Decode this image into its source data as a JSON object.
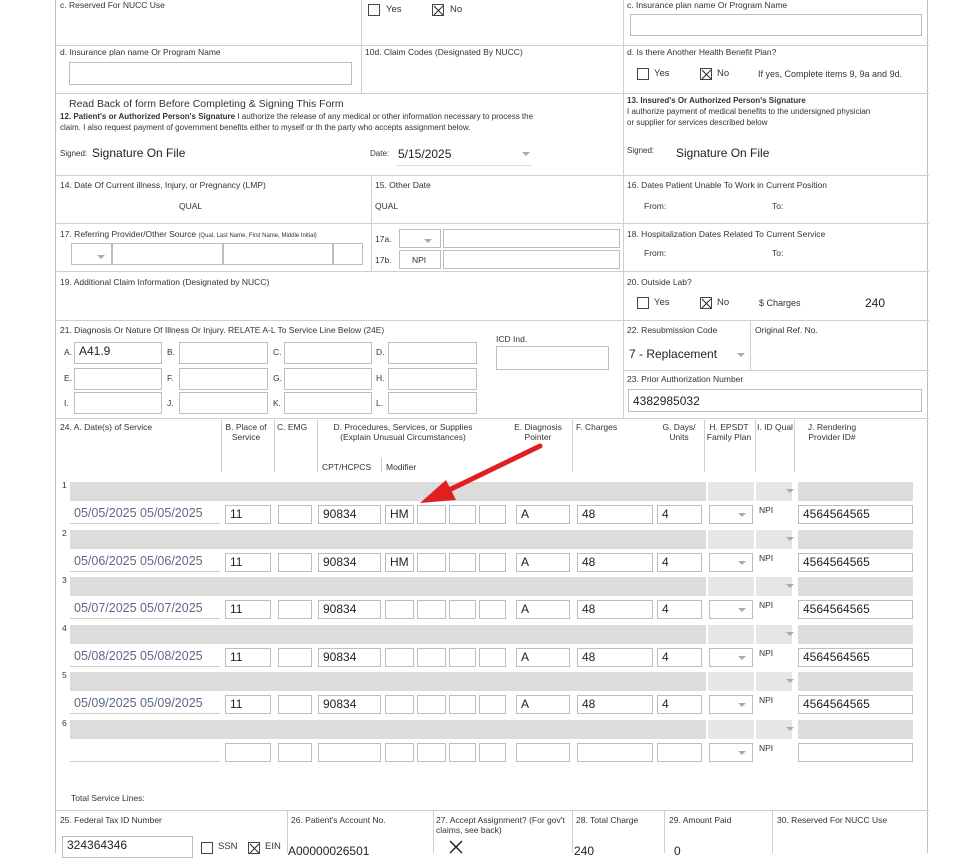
{
  "top": {
    "reserved_nucc": "c. Reserved For NUCC Use",
    "yes": "Yes",
    "no": "No",
    "ins_plan_c": "c. Insurance plan name Or Program Name"
  },
  "row_d": {
    "ins_plan_d": "d. Insurance plan name Or Program Name",
    "claim_codes": "10d. Claim Codes (Designated By NUCC)",
    "another_plan": "d. Is there Another Health Benefit Plan?",
    "yes": "Yes",
    "no": "No",
    "note": "If yes, Complete items 9, 9a and 9d."
  },
  "sig12": {
    "read_back": "Read Back of form Before Completing & Signing This Form",
    "title": "12. Patient's or Authorized Person's Signature",
    "text1": "I authorize the release of any medical or other information necessary to process the",
    "text2": "claim. I also request payment of government benefits either to myself or th the party who accepts assignment below.",
    "signed_label": "Signed:",
    "signed_value": "Signature On File",
    "date_label": "Date:",
    "date_value": "5/15/2025"
  },
  "sig13": {
    "title": "13. Insured's Or Authorized Person's Signature",
    "text1": "I authorize payment of medical benefits to the undersigned physician",
    "text2": "or supplier for services described below",
    "signed_label": "Signed:",
    "signed_value": "Signature On File"
  },
  "row14": {
    "f14": "14. Date Of Current illness, Injury, or Pregnancy (LMP)",
    "qual14": "QUAL",
    "f15": "15. Other Date",
    "qual15": "QUAL",
    "f16": "16. Dates Patient Unable To Work in Current Position",
    "from": "From:",
    "to": "To:"
  },
  "row17": {
    "f17": "17. Referring Provider/Other Source",
    "f17_small": "(Qual, Last Name, First Name, Middle Initial)",
    "f17a": "17a.",
    "f17b": "17b.",
    "npi": "NPI",
    "f18": "18. Hospitalization Dates Related To Current Service",
    "from": "From:",
    "to": "To:"
  },
  "row19": {
    "f19": "19. Additional Claim Information (Designated by NUCC)",
    "f20": "20. Outside Lab?",
    "yes": "Yes",
    "no": "No",
    "charges_label": "$ Charges",
    "charges_value": "240"
  },
  "row21": {
    "f21": "21. Diagnosis Or Nature Of Illness Or Injury. RELATE A-L To Service Line Below (24E)",
    "icd": "ICD Ind.",
    "letters": [
      "A.",
      "B.",
      "C.",
      "D.",
      "E.",
      "F.",
      "G.",
      "H.",
      "I.",
      "J.",
      "K.",
      "L."
    ],
    "dx_a": "A41.9",
    "f22": "22. Resubmission Code",
    "orig_ref": "Original Ref. No.",
    "resub_value": "7 - Replacement",
    "f23": "23. Prior Authorization Number",
    "prior_auth": "4382985032"
  },
  "svc_header": {
    "a": "24. A. Date(s) of Service",
    "b": "B. Place of Service",
    "c": "C. EMG",
    "d": "D. Procedures, Services, or Supplies (Explain Unusual Circumstances)",
    "cpt": "CPT/HCPCS",
    "modifier": "Modifier",
    "e": "E. Diagnosis Pointer",
    "f": "F. Charges",
    "g": "G. Days/ Units",
    "h": "H. EPSDT Family Plan",
    "i": "I. ID Qual",
    "j": "J. Rendering Provider ID#"
  },
  "service_lines": [
    {
      "num": "1",
      "dates": "05/05/2025 05/05/2025",
      "pos": "11",
      "cpt": "90834",
      "mod": "HM",
      "ptr": "A",
      "charge": "48",
      "units": "4",
      "qual": "NPI",
      "npi": "4564564565"
    },
    {
      "num": "2",
      "dates": "05/06/2025 05/06/2025",
      "pos": "11",
      "cpt": "90834",
      "mod": "HM",
      "ptr": "A",
      "charge": "48",
      "units": "4",
      "qual": "NPI",
      "npi": "4564564565"
    },
    {
      "num": "3",
      "dates": "05/07/2025 05/07/2025",
      "pos": "11",
      "cpt": "90834",
      "mod": "",
      "ptr": "A",
      "charge": "48",
      "units": "4",
      "qual": "NPI",
      "npi": "4564564565"
    },
    {
      "num": "4",
      "dates": "05/08/2025 05/08/2025",
      "pos": "11",
      "cpt": "90834",
      "mod": "",
      "ptr": "A",
      "charge": "48",
      "units": "4",
      "qual": "NPI",
      "npi": "4564564565"
    },
    {
      "num": "5",
      "dates": "05/09/2025 05/09/2025",
      "pos": "11",
      "cpt": "90834",
      "mod": "",
      "ptr": "A",
      "charge": "48",
      "units": "4",
      "qual": "NPI",
      "npi": "4564564565"
    },
    {
      "num": "6",
      "dates": "",
      "pos": "",
      "cpt": "",
      "mod": "",
      "ptr": "",
      "charge": "",
      "units": "",
      "qual": "NPI",
      "npi": ""
    }
  ],
  "bottom": {
    "total_lines": "Total Service Lines:",
    "f25": "25. Federal Tax ID Number",
    "tax_id": "324364346",
    "ssn": "SSN",
    "ein": "EIN",
    "f26": "26. Patient's Account No.",
    "account": "A00000026501",
    "f27": "27. Accept Assignment? (For gov't claims, see back)",
    "f28": "28. Total Charge",
    "total_charge": "240",
    "f29": "29. Amount Paid",
    "amount_paid": "0",
    "f30": "30. Reserved For NUCC Use"
  },
  "colors": {
    "annotation_arrow": "#e02020",
    "shade": "#dcdcdc"
  }
}
